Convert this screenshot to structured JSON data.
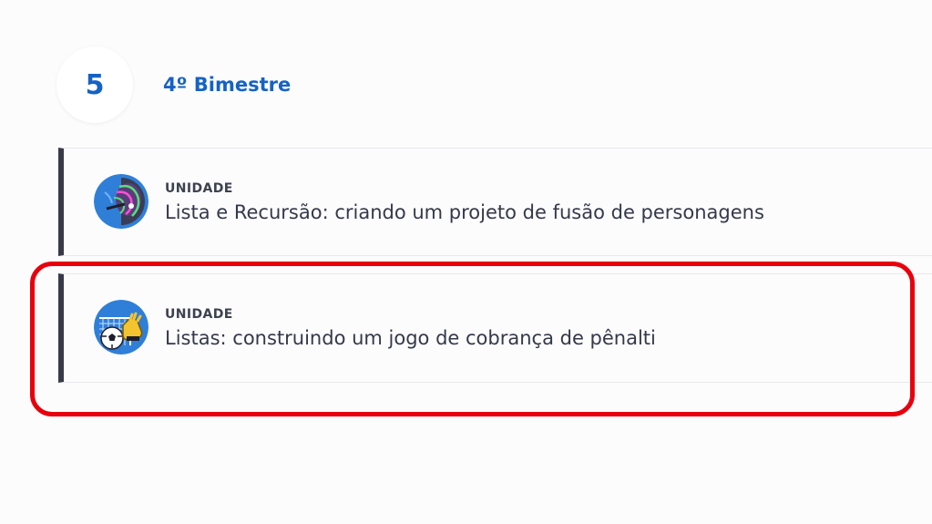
{
  "section": {
    "number": "5",
    "title": "4º Bimestre"
  },
  "units": [
    {
      "kicker": "UNIDADE",
      "title": "Lista e Recursão: criando um projeto de fusão de personagens",
      "icon": "character-fusion-icon"
    },
    {
      "kicker": "UNIDADE",
      "title": "Listas: construindo um jogo de cobrança de pênalti",
      "icon": "penalty-kick-icon"
    }
  ],
  "colors": {
    "accent": "#1662c5",
    "text": "#34394a",
    "card_border": "#383a47",
    "highlight": "#e8000d",
    "background": "#fcfcfd"
  }
}
